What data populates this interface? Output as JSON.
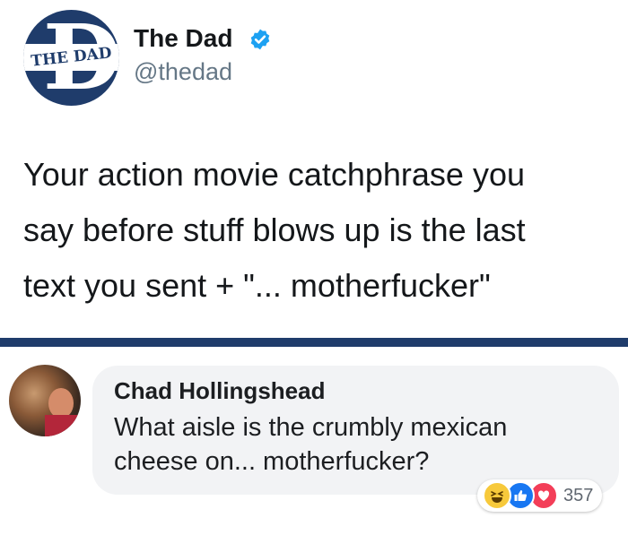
{
  "tweet": {
    "logo_text": "THE DAD",
    "display_name": "The Dad",
    "handle": "@thedad",
    "text": "Your action movie catchphrase you\nsay before stuff blows up is the last\ntext you sent + \"... motherfucker\""
  },
  "comment": {
    "author": "Chad Hollingshead",
    "text": "What aisle is the crumbly mexican\ncheese on... motherfucker?",
    "reaction_count": "357",
    "reactions": [
      "haha-icon",
      "like-icon",
      "love-icon"
    ]
  },
  "colors": {
    "brand_navy": "#1f3c6b",
    "verified_blue": "#1da1f2",
    "bubble_bg": "#f2f3f5"
  }
}
